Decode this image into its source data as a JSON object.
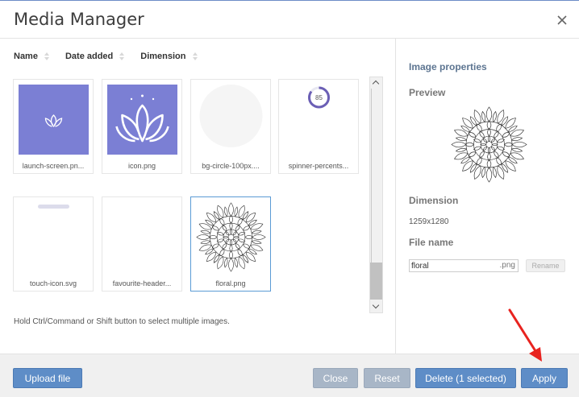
{
  "dialog": {
    "title": "Media Manager"
  },
  "sort": {
    "items": [
      {
        "label": "Name"
      },
      {
        "label": "Date added"
      },
      {
        "label": "Dimension"
      }
    ]
  },
  "media": {
    "items": [
      {
        "caption": "launch-screen.pn...",
        "thumb": "lotus-outline-on-purple",
        "selected": false
      },
      {
        "caption": "icon.png",
        "thumb": "lotus-large-on-purple",
        "selected": false
      },
      {
        "caption": "bg-circle-100px....",
        "thumb": "light-gray-circle",
        "selected": false
      },
      {
        "caption": "spinner-percents...",
        "thumb": "progress-spinner",
        "spinner_value": "85",
        "spinner_fraction": 0.85,
        "selected": false
      },
      {
        "caption": "touch-icon.svg",
        "thumb": "gray-pill",
        "selected": false
      },
      {
        "caption": "favourite-header...",
        "thumb": "blank",
        "selected": false
      },
      {
        "caption": "floral.png",
        "thumb": "mandala",
        "selected": true
      }
    ],
    "hint": "Hold Ctrl/Command or Shift button to select multiple images."
  },
  "properties": {
    "title": "Image properties",
    "preview_label": "Preview",
    "dimension_label": "Dimension",
    "dimension_value": "1259x1280",
    "filename_label": "File name",
    "filename_value": "floral",
    "filename_ext": ".png",
    "rename_label": "Rename"
  },
  "footer": {
    "upload_label": "Upload file",
    "close_label": "Close",
    "reset_label": "Reset",
    "delete_label": "Delete (1 selected)",
    "apply_label": "Apply"
  },
  "colors": {
    "accent": "#5e8dc7",
    "muted_button": "#a8b6c7",
    "thumb_purple": "#7b7fd4",
    "selection_border": "#5b9bd5",
    "annotation_arrow": "#e8231f"
  },
  "icons": [
    "close-icon",
    "sort-arrows-icon",
    "scroll-up-icon",
    "scroll-down-icon",
    "lotus-icon",
    "mandala-image",
    "annotation-arrow"
  ]
}
